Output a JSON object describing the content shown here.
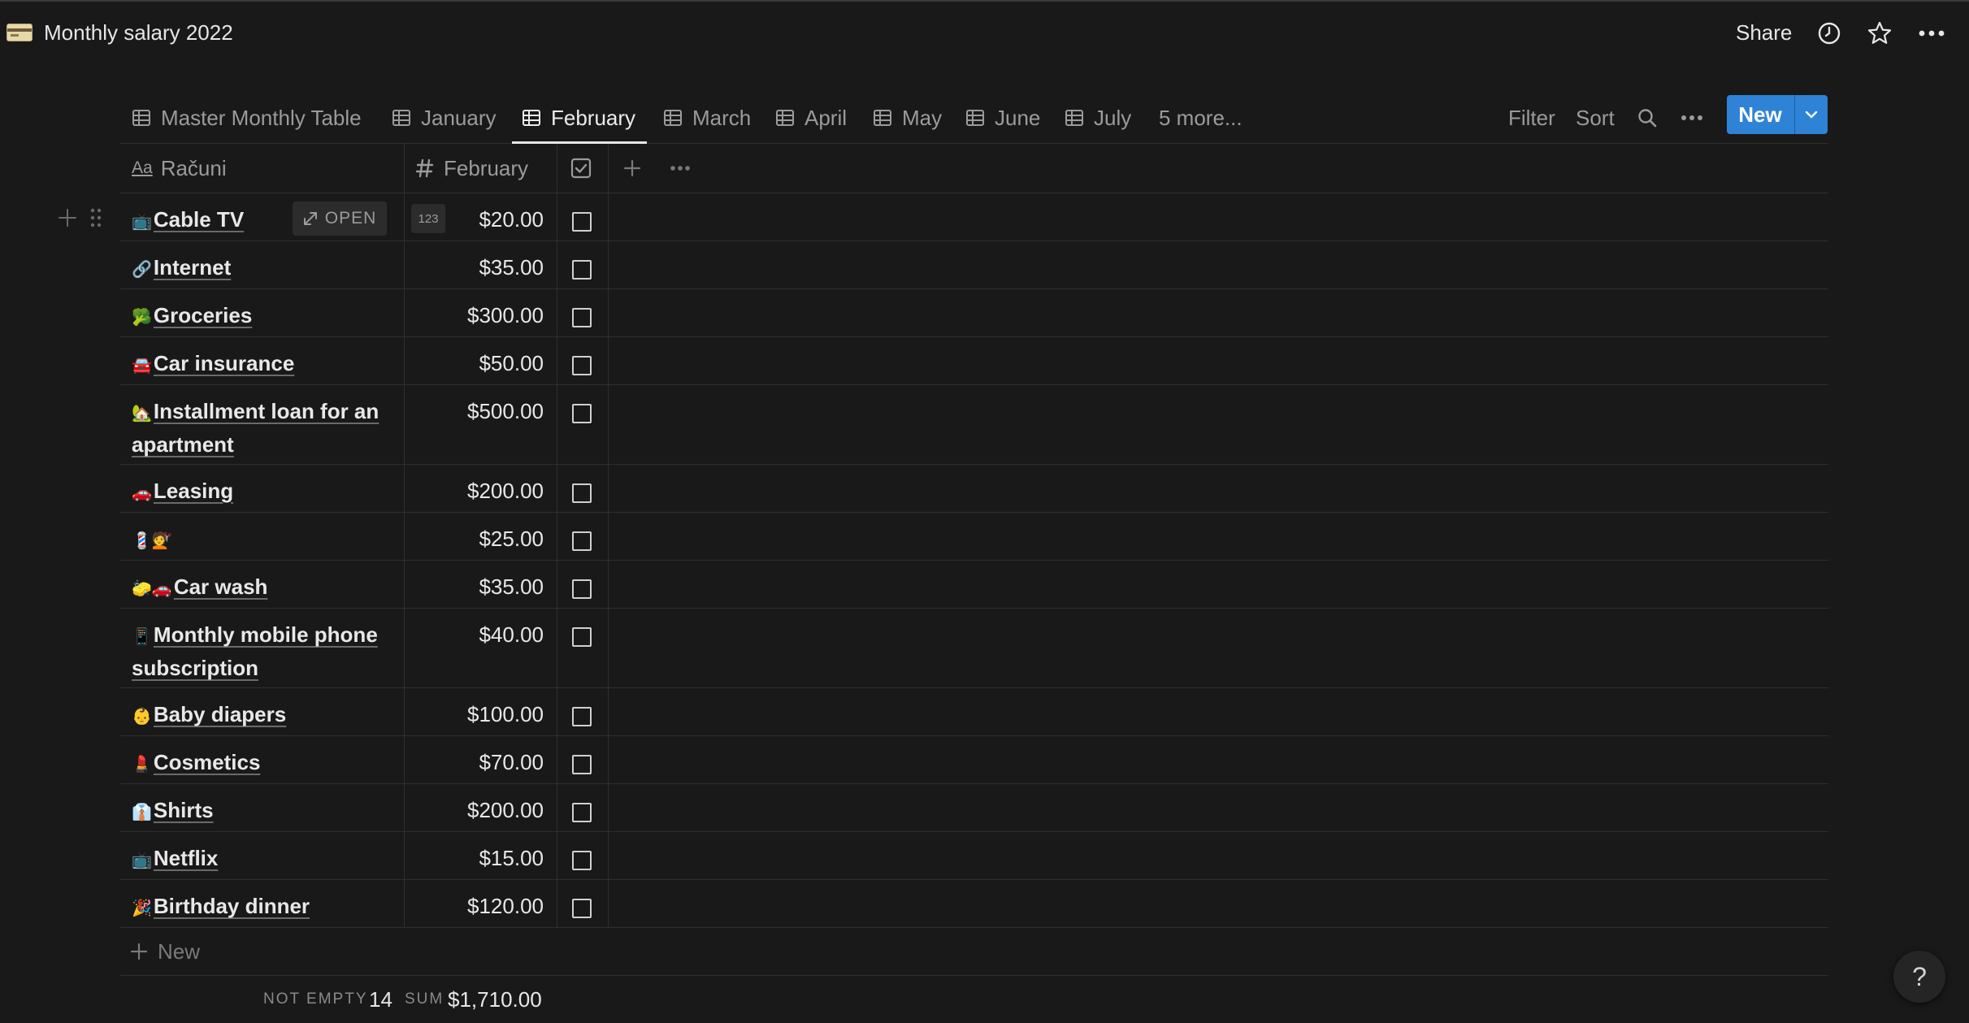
{
  "page": {
    "title": "Monthly salary 2022",
    "icon": "credit-card-icon"
  },
  "header": {
    "share_label": "Share",
    "icons": [
      "clock-icon",
      "star-icon",
      "more-icon"
    ]
  },
  "tabs": [
    {
      "label": "Master Monthly Table",
      "icon": "table-icon",
      "active": false
    },
    {
      "label": "January",
      "icon": "table-icon",
      "active": false
    },
    {
      "label": "February",
      "icon": "table-icon",
      "active": true
    },
    {
      "label": "March",
      "icon": "table-icon",
      "active": false
    },
    {
      "label": "April",
      "icon": "table-icon",
      "active": false
    },
    {
      "label": "May",
      "icon": "table-icon",
      "active": false
    },
    {
      "label": "June",
      "icon": "table-icon",
      "active": false
    },
    {
      "label": "July",
      "icon": "table-icon",
      "active": false
    }
  ],
  "tabs_more": "5 more...",
  "toolbar": {
    "filter": "Filter",
    "sort": "Sort",
    "new_label": "New"
  },
  "columns": {
    "name": "Računi",
    "name_icon_text": "Aa",
    "amount": "February"
  },
  "rows": [
    {
      "emoji": "📺",
      "name": "Cable TV",
      "amount": "$20.00",
      "checked": false
    },
    {
      "emoji": "🔗",
      "name": "Internet",
      "amount": "$35.00",
      "checked": false
    },
    {
      "emoji": "🥦",
      "name": "Groceries",
      "amount": "$300.00",
      "checked": false
    },
    {
      "emoji": "🚘",
      "name": "Car insurance",
      "amount": "$50.00",
      "checked": false
    },
    {
      "emoji": "🏡",
      "name": "Installment loan for an apartment",
      "amount": "$500.00",
      "checked": false
    },
    {
      "emoji": "🚗",
      "name": "Leasing",
      "amount": "$200.00",
      "checked": false
    },
    {
      "emoji": "💈💇",
      "name": "",
      "amount": "$25.00",
      "checked": false
    },
    {
      "emoji": "🧽🚗",
      "name": "Car wash",
      "amount": "$35.00",
      "checked": false
    },
    {
      "emoji": "📱",
      "name": "Monthly mobile phone subscription",
      "amount": "$40.00",
      "checked": false
    },
    {
      "emoji": "👶",
      "name": "Baby diapers",
      "amount": "$100.00",
      "checked": false
    },
    {
      "emoji": "💄",
      "name": "Cosmetics",
      "amount": "$70.00",
      "checked": false
    },
    {
      "emoji": "👔",
      "name": "Shirts",
      "amount": "$200.00",
      "checked": false
    },
    {
      "emoji": "📺",
      "name": "Netflix",
      "amount": "$15.00",
      "checked": false
    },
    {
      "emoji": "🎉",
      "name": "Birthday dinner",
      "amount": "$120.00",
      "checked": false
    }
  ],
  "row_hover": {
    "open_label": "OPEN",
    "number_badge": "123"
  },
  "new_row_label": "New",
  "footer": {
    "count_label": "NOT EMPTY",
    "count_value": "14",
    "sum_label": "SUM",
    "sum_value": "$1,710.00"
  },
  "help_label": "?"
}
